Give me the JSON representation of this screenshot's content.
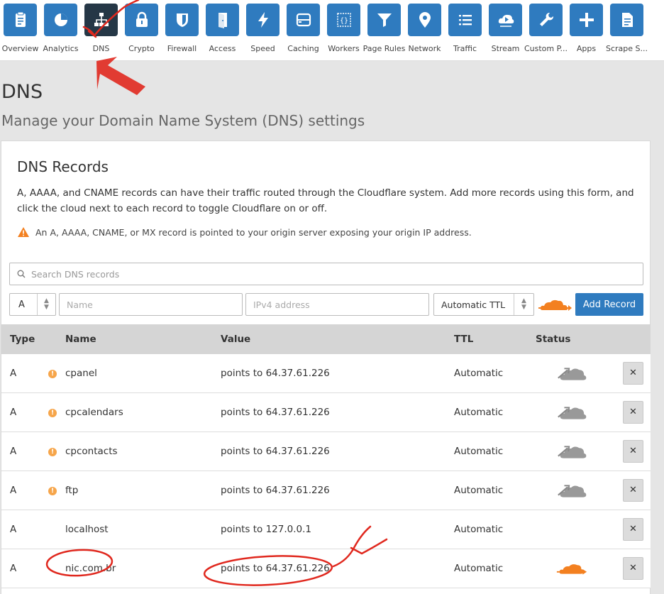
{
  "nav": {
    "items": [
      {
        "label": "Overview",
        "icon": "clipboard-icon"
      },
      {
        "label": "Analytics",
        "icon": "pie-chart-icon"
      },
      {
        "label": "DNS",
        "icon": "network-tree-icon",
        "active": true
      },
      {
        "label": "Crypto",
        "icon": "lock-icon"
      },
      {
        "label": "Firewall",
        "icon": "shield-icon"
      },
      {
        "label": "Access",
        "icon": "door-icon"
      },
      {
        "label": "Speed",
        "icon": "lightning-icon"
      },
      {
        "label": "Caching",
        "icon": "server-icon"
      },
      {
        "label": "Workers",
        "icon": "braces-icon"
      },
      {
        "label": "Page Rules",
        "icon": "filter-icon"
      },
      {
        "label": "Network",
        "icon": "location-pin-icon"
      },
      {
        "label": "Traffic",
        "icon": "list-icon"
      },
      {
        "label": "Stream",
        "icon": "cloud-play-icon"
      },
      {
        "label": "Custom P...",
        "icon": "wrench-icon"
      },
      {
        "label": "Apps",
        "icon": "plus-icon"
      },
      {
        "label": "Scrape S...",
        "icon": "document-icon"
      }
    ]
  },
  "page": {
    "title": "DNS",
    "subtitle": "Manage your Domain Name System (DNS) settings"
  },
  "card": {
    "title": "DNS Records",
    "description": "A, AAAA, and CNAME records can have their traffic routed through the Cloudflare system. Add more records using this form, and click the cloud next to each record to toggle Cloudflare on or off.",
    "warning": "An A, AAAA, CNAME, or MX record is pointed to your origin server exposing your origin IP address."
  },
  "form": {
    "search_placeholder": "Search DNS records",
    "type_value": "A",
    "name_placeholder": "Name",
    "value_placeholder": "IPv4 address",
    "ttl_value": "Automatic TTL",
    "add_label": "Add Record"
  },
  "table": {
    "headers": {
      "type": "Type",
      "name": "Name",
      "value": "Value",
      "ttl": "TTL",
      "status": "Status"
    },
    "rows": [
      {
        "type": "A",
        "name": "cpanel",
        "value": "points to 64.37.61.226",
        "ttl": "Automatic",
        "proxied": false,
        "warn": true
      },
      {
        "type": "A",
        "name": "cpcalendars",
        "value": "points to 64.37.61.226",
        "ttl": "Automatic",
        "proxied": false,
        "warn": true
      },
      {
        "type": "A",
        "name": "cpcontacts",
        "value": "points to 64.37.61.226",
        "ttl": "Automatic",
        "proxied": false,
        "warn": true
      },
      {
        "type": "A",
        "name": "ftp",
        "value": "points to 64.37.61.226",
        "ttl": "Automatic",
        "proxied": false,
        "warn": true
      },
      {
        "type": "A",
        "name": "localhost",
        "value": "points to 127.0.0.1",
        "ttl": "Automatic",
        "proxied": null,
        "warn": false
      },
      {
        "type": "A",
        "name": "nic.com.br",
        "value": "points to 64.37.61.226",
        "ttl": "Automatic",
        "proxied": true,
        "warn": false
      }
    ]
  },
  "colors": {
    "nav_tile": "#2f7bbf",
    "nav_tile_active": "#253746",
    "cloud_on": "#f38020",
    "cloud_off": "#999999",
    "annotation": "#e0281e"
  }
}
